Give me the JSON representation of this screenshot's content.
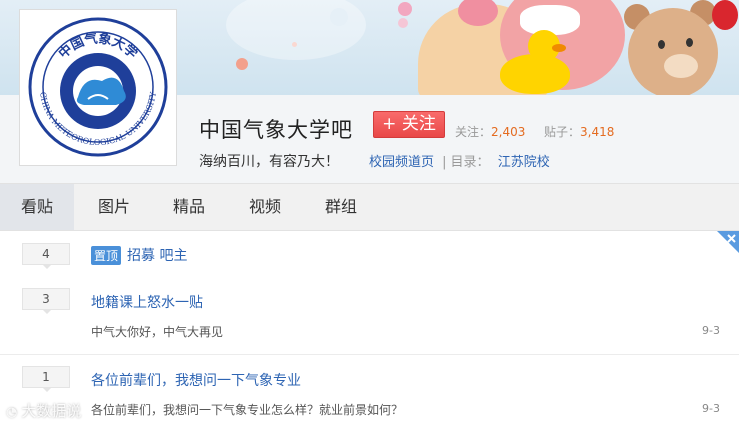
{
  "forum": {
    "title": "中国气象大学吧",
    "follow_label": "+ 关注",
    "slogan": "海纳百川，有容乃大！",
    "stats": {
      "follow_label": "关注：",
      "follow_count": "2,403",
      "posts_label": "贴子：",
      "posts_count": "3,418"
    },
    "links": {
      "campus": "校园频道页",
      "separator": "|",
      "dir_label": "目录：",
      "dir_value": "江苏院校"
    },
    "logo_text": {
      "cn": "中国气象大学",
      "en": "CHINA METEOROLOGICAL UNIVERSITY"
    }
  },
  "tabs": [
    {
      "label": "看贴",
      "active": true
    },
    {
      "label": "图片",
      "active": false
    },
    {
      "label": "精品",
      "active": false
    },
    {
      "label": "视频",
      "active": false
    },
    {
      "label": "群组",
      "active": false
    }
  ],
  "threads": [
    {
      "replies": "4",
      "badge": "置顶",
      "title": "招募 吧主",
      "abstract": "",
      "time": ""
    },
    {
      "replies": "3",
      "badge": "",
      "title": "地籍课上怒水一贴",
      "abstract": "中气大你好，中气大再见",
      "time": "9-3"
    },
    {
      "replies": "1",
      "badge": "",
      "title": "各位前辈们，我想问一下气象专业",
      "abstract": "各位前辈们，我想问一下气象专业怎么样？就业前景如何？",
      "time": "9-3"
    }
  ],
  "watermark": "大数据说",
  "colors": {
    "accent_link": "#2d64b3",
    "follow_red": "#e94848",
    "stat_orange": "#e46b20",
    "logo_blue": "#1f3f9a"
  },
  "icons": {
    "close": "close-icon",
    "logo": "university-logo"
  }
}
